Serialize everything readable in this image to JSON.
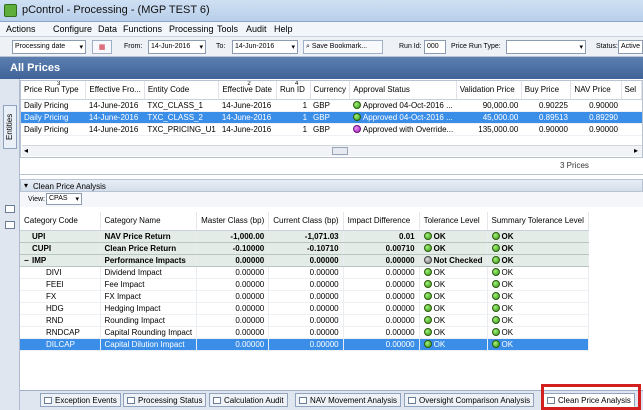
{
  "window": {
    "title": "pControl - Processing - (MGP TEST 6)"
  },
  "menu": [
    "Actions",
    "Configure",
    "Data",
    "Functions",
    "Processing",
    "Tools",
    "Audit",
    "Help"
  ],
  "toolbar": {
    "processing_date": "Processing date",
    "from_label": "From:",
    "from_value": "14-Jun-2016",
    "to_label": "To:",
    "to_value": "14-Jun-2016",
    "save_bookmark": "Save Bookmark...",
    "run_id_label": "Run Id:",
    "run_id_value": "000",
    "price_run_type_label": "Price Run Type:",
    "status_label": "Status:",
    "status_value": "Active"
  },
  "banner": {
    "title": "All Prices"
  },
  "sidetab": {
    "label": "Entities"
  },
  "prices": {
    "sort_markers": {
      "c0": "3",
      "c3": "2",
      "c4": "4"
    },
    "columns": [
      "Price Run Type",
      "Effective Fro...",
      "Entity Code",
      "Effective Date",
      "Run ID",
      "Currency",
      "Approval Status",
      "Validation Price",
      "Buy Price",
      "NAV Price",
      "Sel"
    ],
    "rows": [
      [
        "Daily Pricing",
        "14-June-2016",
        "TXC_CLASS_1",
        "14-June-2016",
        "1",
        "GBP",
        "Approved 04-Oct-2016 ...",
        "90,000.00",
        "0.90225",
        "0.90000",
        ""
      ],
      [
        "Daily Pricing",
        "14-June-2016",
        "TXC_CLASS_2",
        "14-June-2016",
        "1",
        "GBP",
        "Approved 04-Oct-2016 ...",
        "45,000.00",
        "0.89513",
        "0.89290",
        ""
      ],
      [
        "Daily Pricing",
        "14-June-2016",
        "TXC_PRICING_U1",
        "14-June-2016",
        "1",
        "GBP",
        "Approved with Override...",
        "135,000.00",
        "0.90000",
        "0.90000",
        ""
      ]
    ],
    "row_status": [
      "green",
      "green",
      "purple"
    ],
    "count_text": "3 Prices"
  },
  "cpa": {
    "title": "Clean Price Analysis",
    "view_label": "View:",
    "view_value": "CPAS",
    "columns": [
      "Category Code",
      "Category Name",
      "Master Class (bp)",
      "Current Class (bp)",
      "Impact Difference",
      "Tolerance Level",
      "Summary Tolerance Level"
    ],
    "rows": [
      {
        "code": "UPI",
        "name": "NAV Price Return",
        "master": "-1,000.00",
        "current": "-1,071.03",
        "diff": "0.01",
        "tol": "OK",
        "tol_color": "green",
        "sum": "OK",
        "group": true
      },
      {
        "code": "CUPI",
        "name": "Clean Price Return",
        "master": "-0.10000",
        "current": "-0.10710",
        "diff": "0.00710",
        "tol": "OK",
        "tol_color": "green",
        "sum": "OK",
        "group": true
      },
      {
        "code": "IMP",
        "name": "Performance Impacts",
        "master": "0.00000",
        "current": "0.00000",
        "diff": "0.00000",
        "tol": "Not Checked",
        "tol_color": "gray",
        "sum": "OK",
        "group": true,
        "expand": "−"
      },
      {
        "code": "DIVI",
        "name": "Dividend Impact",
        "master": "0.00000",
        "current": "0.00000",
        "diff": "0.00000",
        "tol": "OK",
        "tol_color": "green",
        "sum": "OK"
      },
      {
        "code": "FEEI",
        "name": "Fee Impact",
        "master": "0.00000",
        "current": "0.00000",
        "diff": "0.00000",
        "tol": "OK",
        "tol_color": "green",
        "sum": "OK"
      },
      {
        "code": "FX",
        "name": "FX Impact",
        "master": "0.00000",
        "current": "0.00000",
        "diff": "0.00000",
        "tol": "OK",
        "tol_color": "green",
        "sum": "OK"
      },
      {
        "code": "HDG",
        "name": "Hedging Impact",
        "master": "0.00000",
        "current": "0.00000",
        "diff": "0.00000",
        "tol": "OK",
        "tol_color": "green",
        "sum": "OK"
      },
      {
        "code": "RND",
        "name": "Rounding Impact",
        "master": "0.00000",
        "current": "0.00000",
        "diff": "0.00000",
        "tol": "OK",
        "tol_color": "green",
        "sum": "OK"
      },
      {
        "code": "RNDCAP",
        "name": "Capital Rounding Impact",
        "master": "0.00000",
        "current": "0.00000",
        "diff": "0.00000",
        "tol": "OK",
        "tol_color": "green",
        "sum": "OK"
      },
      {
        "code": "DILCAP",
        "name": "Capital Dilution Impact",
        "master": "0.00000",
        "current": "0.00000",
        "diff": "0.00000",
        "tol": "OK",
        "tol_color": "green",
        "sum": "OK",
        "selected": true
      }
    ]
  },
  "bottom_tabs": [
    "Exception Events",
    "Processing Status",
    "Calculation Audit",
    "NAV Movement Analysis",
    "Oversight Comparison Analysis",
    "Clean Price Analysis"
  ],
  "colors": {
    "selection": "#3b8ee8",
    "banner": "#4a6ea3",
    "highlight": "#d21f1f"
  }
}
